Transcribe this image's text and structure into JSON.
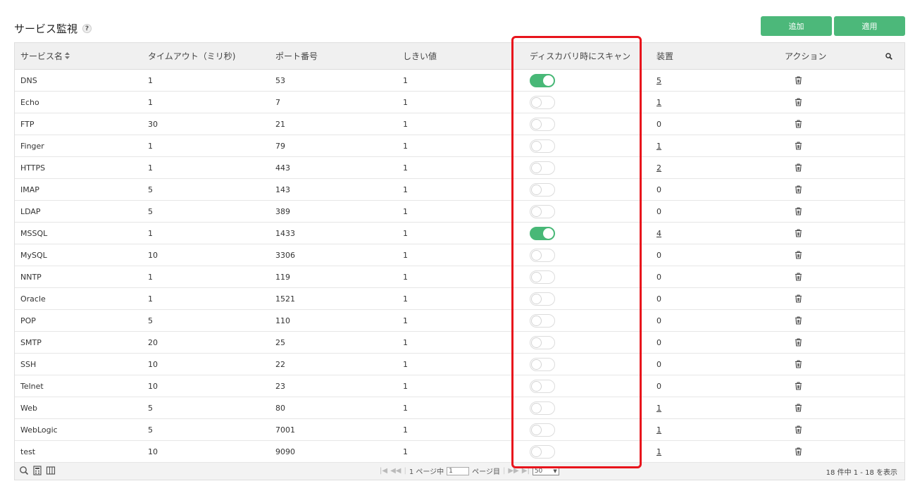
{
  "page": {
    "title": "サービス監視",
    "help_label": "?"
  },
  "toolbar": {
    "add_label": "追加",
    "apply_label": "適用"
  },
  "columns": {
    "name": "サービス名",
    "timeout": "タイムアウト（ミリ秒)",
    "port": "ポート番号",
    "threshold": "しきい値",
    "discovery_scan": "ディスカバリ時にスキャン",
    "devices": "装置",
    "actions": "アクション"
  },
  "rows": [
    {
      "name": "DNS",
      "timeout": "1",
      "port": "53",
      "threshold": "1",
      "scan": true,
      "devices": "5",
      "devices_link": true
    },
    {
      "name": "Echo",
      "timeout": "1",
      "port": "7",
      "threshold": "1",
      "scan": false,
      "devices": "1",
      "devices_link": true
    },
    {
      "name": "FTP",
      "timeout": "30",
      "port": "21",
      "threshold": "1",
      "scan": false,
      "devices": "0",
      "devices_link": false
    },
    {
      "name": "Finger",
      "timeout": "1",
      "port": "79",
      "threshold": "1",
      "scan": false,
      "devices": "1",
      "devices_link": true
    },
    {
      "name": "HTTPS",
      "timeout": "1",
      "port": "443",
      "threshold": "1",
      "scan": false,
      "devices": "2",
      "devices_link": true
    },
    {
      "name": "IMAP",
      "timeout": "5",
      "port": "143",
      "threshold": "1",
      "scan": false,
      "devices": "0",
      "devices_link": false
    },
    {
      "name": "LDAP",
      "timeout": "5",
      "port": "389",
      "threshold": "1",
      "scan": false,
      "devices": "0",
      "devices_link": false
    },
    {
      "name": "MSSQL",
      "timeout": "1",
      "port": "1433",
      "threshold": "1",
      "scan": true,
      "devices": "4",
      "devices_link": true
    },
    {
      "name": "MySQL",
      "timeout": "10",
      "port": "3306",
      "threshold": "1",
      "scan": false,
      "devices": "0",
      "devices_link": false
    },
    {
      "name": "NNTP",
      "timeout": "1",
      "port": "119",
      "threshold": "1",
      "scan": false,
      "devices": "0",
      "devices_link": false
    },
    {
      "name": "Oracle",
      "timeout": "1",
      "port": "1521",
      "threshold": "1",
      "scan": false,
      "devices": "0",
      "devices_link": false
    },
    {
      "name": "POP",
      "timeout": "5",
      "port": "110",
      "threshold": "1",
      "scan": false,
      "devices": "0",
      "devices_link": false
    },
    {
      "name": "SMTP",
      "timeout": "20",
      "port": "25",
      "threshold": "1",
      "scan": false,
      "devices": "0",
      "devices_link": false
    },
    {
      "name": "SSH",
      "timeout": "10",
      "port": "22",
      "threshold": "1",
      "scan": false,
      "devices": "0",
      "devices_link": false
    },
    {
      "name": "Telnet",
      "timeout": "10",
      "port": "23",
      "threshold": "1",
      "scan": false,
      "devices": "0",
      "devices_link": false
    },
    {
      "name": "Web",
      "timeout": "5",
      "port": "80",
      "threshold": "1",
      "scan": false,
      "devices": "1",
      "devices_link": true
    },
    {
      "name": "WebLogic",
      "timeout": "5",
      "port": "7001",
      "threshold": "1",
      "scan": false,
      "devices": "1",
      "devices_link": true
    },
    {
      "name": "test",
      "timeout": "10",
      "port": "9090",
      "threshold": "1",
      "scan": false,
      "devices": "1",
      "devices_link": true
    }
  ],
  "footer": {
    "page_prefix": "1 ページ中",
    "page_value": "1",
    "page_suffix": "ページ目",
    "per_page": "50",
    "summary": "18 件中 1 - 18 を表示"
  },
  "icons": {
    "sort": "sort-icon",
    "search": "search-icon",
    "delete": "trash-icon"
  },
  "colors": {
    "accent": "#4cb87a",
    "highlight": "#e8141c"
  }
}
